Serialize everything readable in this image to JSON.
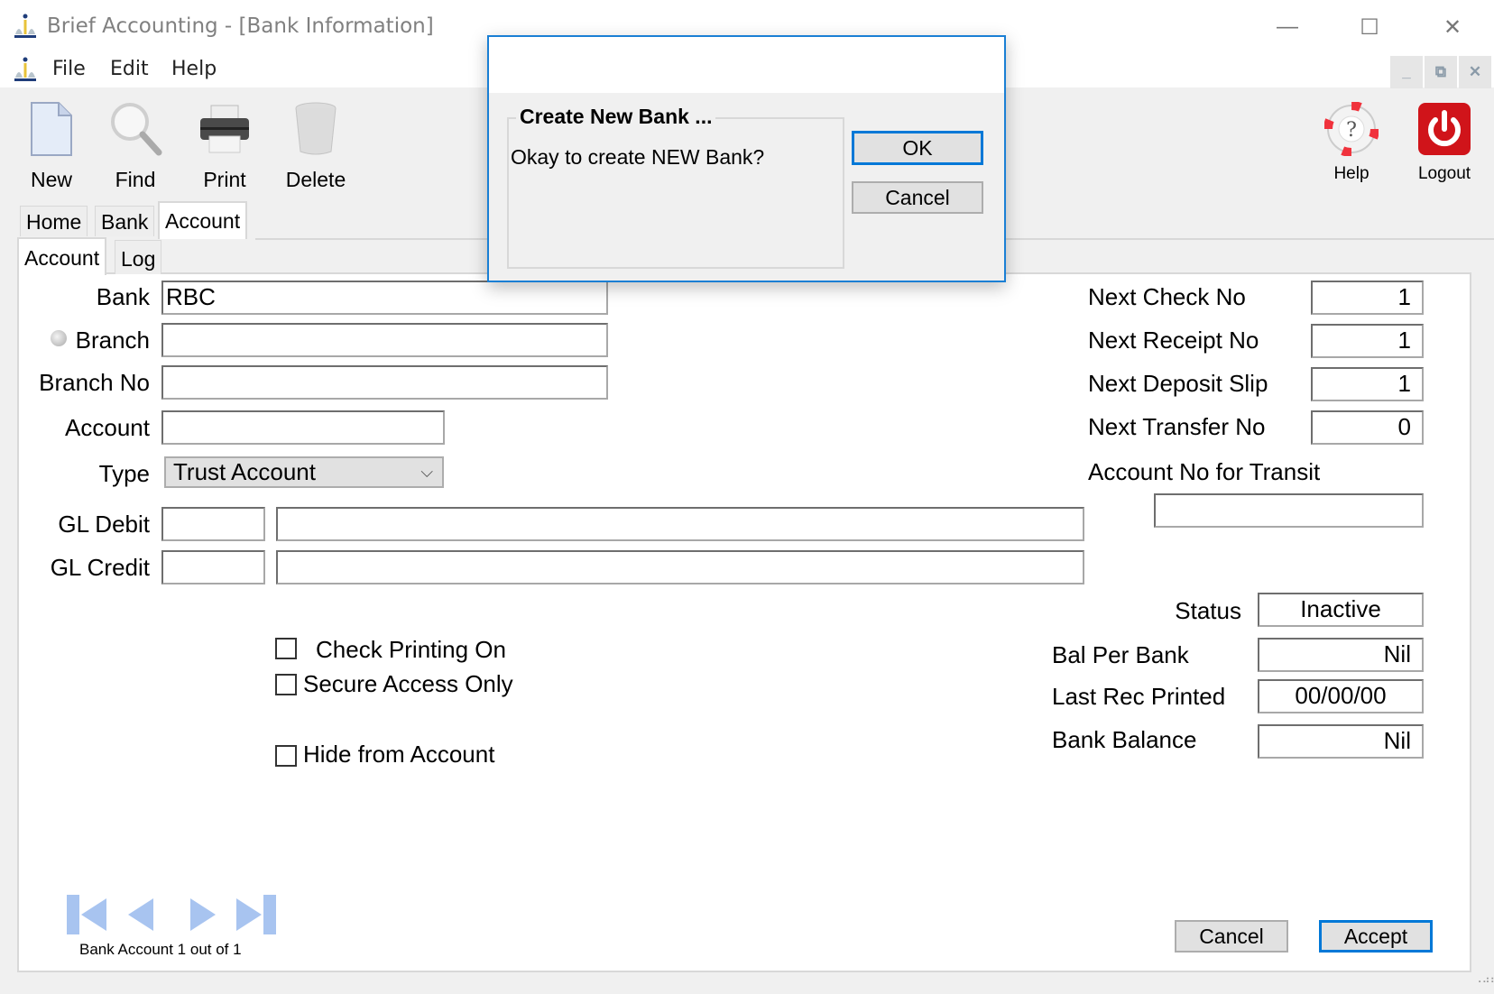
{
  "window": {
    "title": "Brief Accounting - [Bank Information]",
    "controls": {
      "minimize": "—",
      "maximize": "☐",
      "close": "✕"
    }
  },
  "menu": {
    "items": [
      "File",
      "Edit",
      "Help"
    ]
  },
  "mdi_controls": {
    "minimize": "_",
    "restore": "⧉",
    "close": "✕"
  },
  "toolbar": {
    "new": "New",
    "find": "Find",
    "print": "Print",
    "delete": "Delete",
    "help": "Help",
    "logout": "Logout"
  },
  "tabs": {
    "top": [
      {
        "label": "Home",
        "active": false
      },
      {
        "label": "Bank",
        "active": false
      },
      {
        "label": "Account",
        "active": true
      }
    ],
    "sub": [
      {
        "label": "Account",
        "active": true
      },
      {
        "label": "Log",
        "active": false
      }
    ]
  },
  "form": {
    "bank": {
      "label": "Bank",
      "value": "RBC"
    },
    "branch": {
      "label": "Branch",
      "value": ""
    },
    "branch_no": {
      "label": "Branch No",
      "value": ""
    },
    "account": {
      "label": "Account",
      "value": ""
    },
    "type": {
      "label": "Type",
      "value": "Trust Account"
    },
    "gl_debit": {
      "label": "GL Debit",
      "code": "",
      "description": ""
    },
    "gl_credit": {
      "label": "GL Credit",
      "code": "",
      "description": ""
    },
    "next_check_no": {
      "label": "Next Check No",
      "value": "1"
    },
    "next_receipt_no": {
      "label": "Next Receipt No",
      "value": "1"
    },
    "next_deposit_slip": {
      "label": "Next Deposit Slip",
      "value": "1"
    },
    "next_transfer_no": {
      "label": "Next Transfer No",
      "value": "0"
    },
    "account_no_transit": {
      "label": "Account No for Transit",
      "value": ""
    },
    "status": {
      "label": "Status",
      "value": "Inactive"
    },
    "bal_per_bank": {
      "label": "Bal Per Bank",
      "value": "Nil"
    },
    "last_rec_printed": {
      "label": "Last Rec Printed",
      "value": "00/00/00"
    },
    "bank_balance": {
      "label": "Bank Balance",
      "value": "Nil"
    },
    "check_printing_on": {
      "label": "Check Printing On",
      "checked": false
    },
    "secure_access_only": {
      "label": "Secure Access Only",
      "checked": false
    },
    "hide_from_account": {
      "label": "Hide from Account",
      "checked": false
    }
  },
  "navigation": {
    "record_text": "Bank Account 1 out of 1"
  },
  "actions": {
    "cancel": "Cancel",
    "accept": "Accept"
  },
  "dialog": {
    "group_title": "Create New Bank ...",
    "message": "Okay to create NEW Bank?",
    "ok": "OK",
    "cancel": "Cancel"
  },
  "colors": {
    "accent": "#0078d7",
    "dialog_border": "#1a7fd4",
    "logout_red": "#d0141a"
  }
}
